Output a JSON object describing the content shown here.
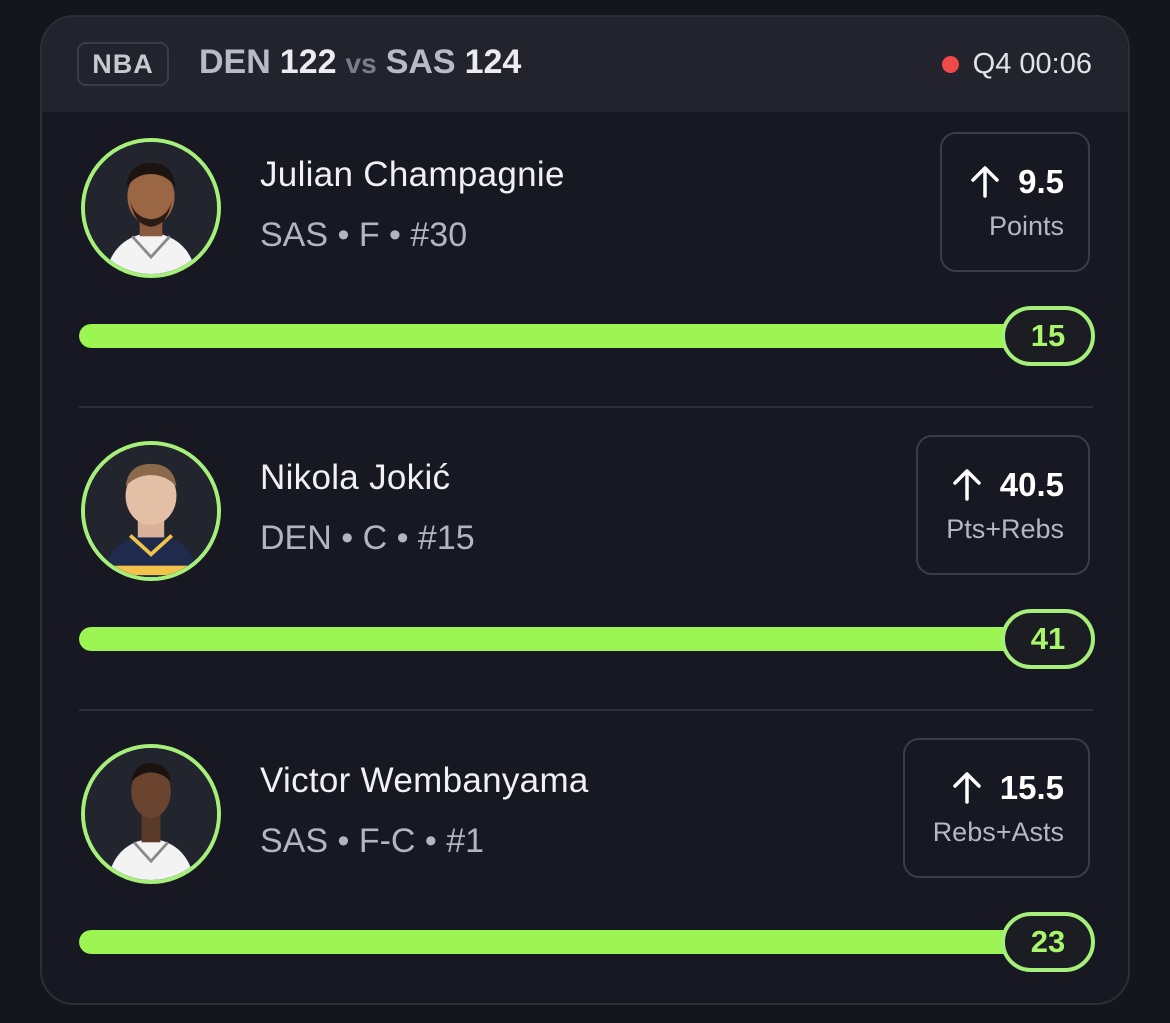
{
  "header": {
    "league": "NBA",
    "away_team": "DEN",
    "away_score": "122",
    "vs": "vs",
    "home_team": "SAS",
    "home_score": "124",
    "period_clock": "Q4 00:06",
    "live_color": "#ef4a4a"
  },
  "accent_color": "#9cf553",
  "players": [
    {
      "name": "Julian Champagnie",
      "meta": "SAS • F • #30",
      "line": "9.5",
      "stat": "Points",
      "direction_icon": "arrow-up-icon",
      "current": "15",
      "progress_fraction": 1.0,
      "jersey": "white"
    },
    {
      "name": "Nikola Jokić",
      "meta": "DEN • C • #15",
      "line": "40.5",
      "stat": "Pts+Rebs",
      "direction_icon": "arrow-up-icon",
      "current": "41",
      "progress_fraction": 1.0,
      "jersey": "navy"
    },
    {
      "name": "Victor Wembanyama",
      "meta": "SAS • F-C • #1",
      "line": "15.5",
      "stat": "Rebs+Asts",
      "direction_icon": "arrow-up-icon",
      "current": "23",
      "progress_fraction": 1.0,
      "jersey": "white"
    }
  ]
}
